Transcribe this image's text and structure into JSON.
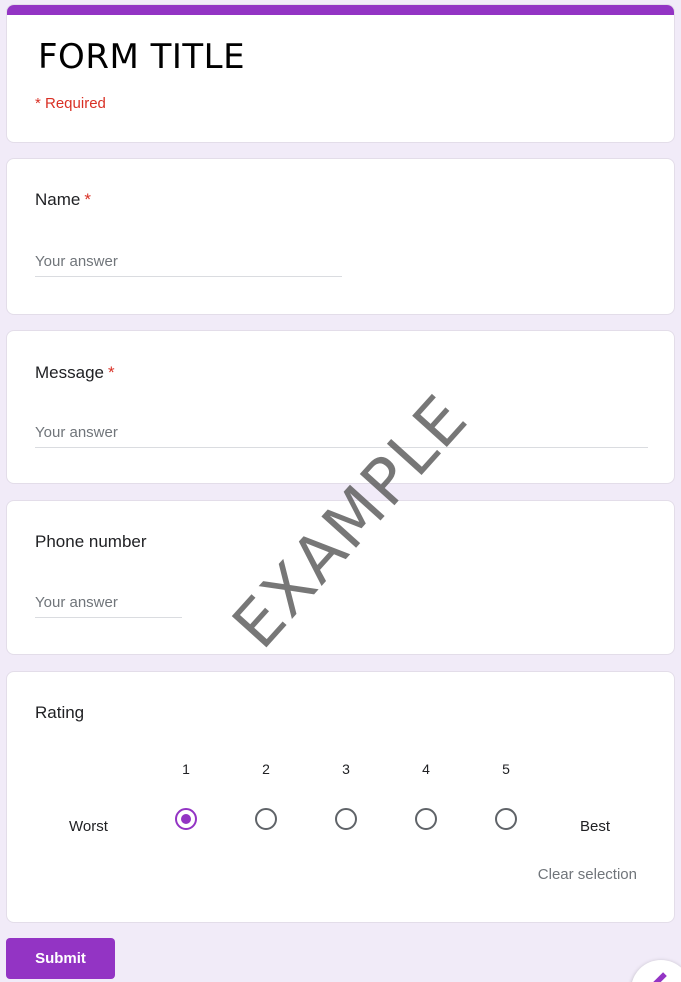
{
  "form": {
    "title": "FORM TITLE",
    "required_note": "* Required"
  },
  "questions": {
    "name": {
      "label": "Name",
      "required_mark": "*",
      "placeholder": "Your answer"
    },
    "message": {
      "label": "Message",
      "required_mark": "*",
      "placeholder": "Your answer"
    },
    "phone": {
      "label": "Phone number",
      "placeholder": "Your answer"
    },
    "rating": {
      "label": "Rating",
      "low_label": "Worst",
      "high_label": "Best",
      "scale": [
        "1",
        "2",
        "3",
        "4",
        "5"
      ],
      "selected": "1",
      "clear_label": "Clear selection"
    }
  },
  "submit_label": "Submit",
  "watermark": "EXAMPLE",
  "colors": {
    "accent": "#9334c4",
    "required": "#d93025",
    "background": "#f1ebf8"
  },
  "icons": {
    "fab": "edit-icon"
  }
}
